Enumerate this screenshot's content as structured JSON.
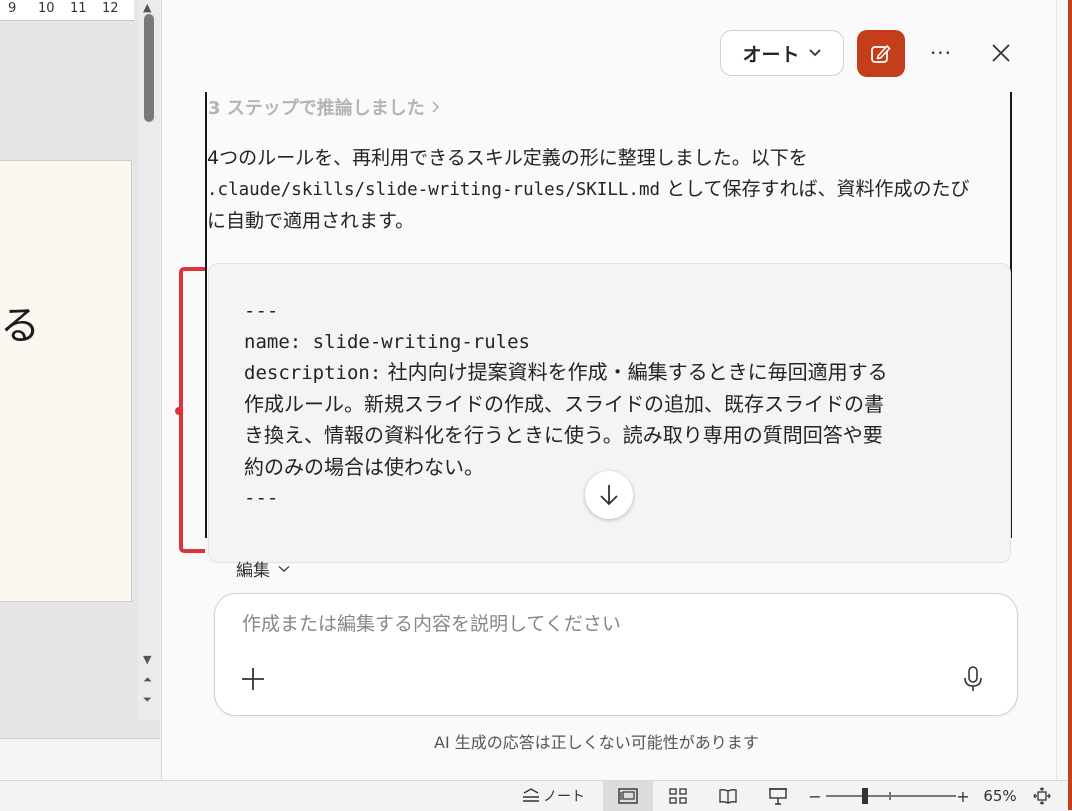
{
  "ruler": {
    "ticks": [
      "9",
      "10",
      "11",
      "12"
    ]
  },
  "slide": {
    "text": "る"
  },
  "header": {
    "mode_label": "オート",
    "compose_icon": "compose-icon",
    "more_label": "···",
    "close_icon": "close-icon"
  },
  "chat": {
    "reasoning_label": "3 ステップで推論しました",
    "reply_lines": [
      "4つのルールを、再利用できるスキル定義の形に整理しました。以下を",
      ".claude/skills/slide-writing-rules/SKILL.md",
      " として保存すれば、資料作成のたび",
      "に自動で適用されます。"
    ],
    "code_lines": [
      "---",
      "name: slide-writing-rules",
      "description:",
      " 社内向け提案資料を作成・編集するときに毎回適用する",
      "作成ルール。新規スライドの作成、スライドの追加、既存スライドの書",
      "き換え、情報の資料化を行うときに使う。読み取り専用の質問回答や要",
      "約のみの場合は使わない。",
      "---"
    ]
  },
  "edit_label": "編集",
  "input": {
    "placeholder": "作成または編集する内容を説明してください",
    "value": ""
  },
  "disclaimer": "AI 生成の応答は正しくない可能性があります",
  "status_bar": {
    "notes_label": "ノート",
    "zoom_out": "−",
    "zoom_in": "+",
    "zoom_level": "65%",
    "zoom_fraction": 0.3
  },
  "colors": {
    "accent": "#c43e1c",
    "annotation": "#e0323a"
  }
}
